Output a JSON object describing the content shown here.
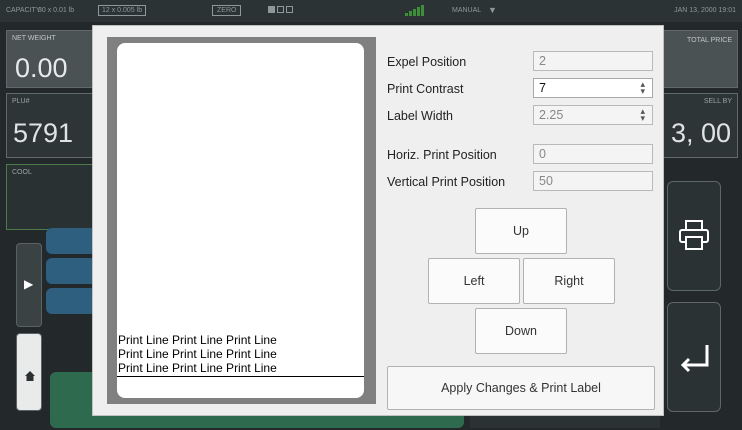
{
  "statusbar": {
    "capacity_label": "CAPACITY",
    "capacity_1": "30 x 0.01 lb",
    "capacity_2": "12 x 0.005 lb",
    "zero": "ZERO",
    "mode": "MANUAL",
    "datetime": "JAN 13, 2000 19:01"
  },
  "background": {
    "net_weight_label": "NET WEIGHT",
    "net_weight_value": "0.00",
    "plu_label": "PLU#",
    "plu_value": "5791",
    "cool_label": "COOL",
    "total_price_label": "TOTAL PRICE",
    "sell_by_label": "SELL BY",
    "sell_by_value": "3, 00"
  },
  "modal": {
    "preview": {
      "print_lines": [
        "Print Line Print Line Print Line",
        "Print Line Print Line Print Line",
        "Print Line Print Line Print Line"
      ]
    },
    "fields": {
      "expel_position": {
        "label": "Expel Position",
        "value": "2"
      },
      "print_contrast": {
        "label": "Print Contrast",
        "value": "7"
      },
      "label_width": {
        "label": "Label Width",
        "value": "2.25"
      },
      "horiz_print_position": {
        "label": "Horiz. Print Position",
        "value": "0"
      },
      "vertical_print_position": {
        "label": "Vertical Print Position",
        "value": "50"
      }
    },
    "buttons": {
      "up": "Up",
      "left": "Left",
      "right": "Right",
      "down": "Down",
      "apply": "Apply Changes & Print Label"
    }
  },
  "icons": {
    "play": "play-icon",
    "home": "home-icon",
    "printer": "printer-icon",
    "enter": "enter-return-icon",
    "spinner": "spinner-arrows-icon"
  },
  "colors": {
    "status_green": "#3e8e3a",
    "accent_blue": "#2e5f7e",
    "accent_green": "#2e6b4e"
  }
}
